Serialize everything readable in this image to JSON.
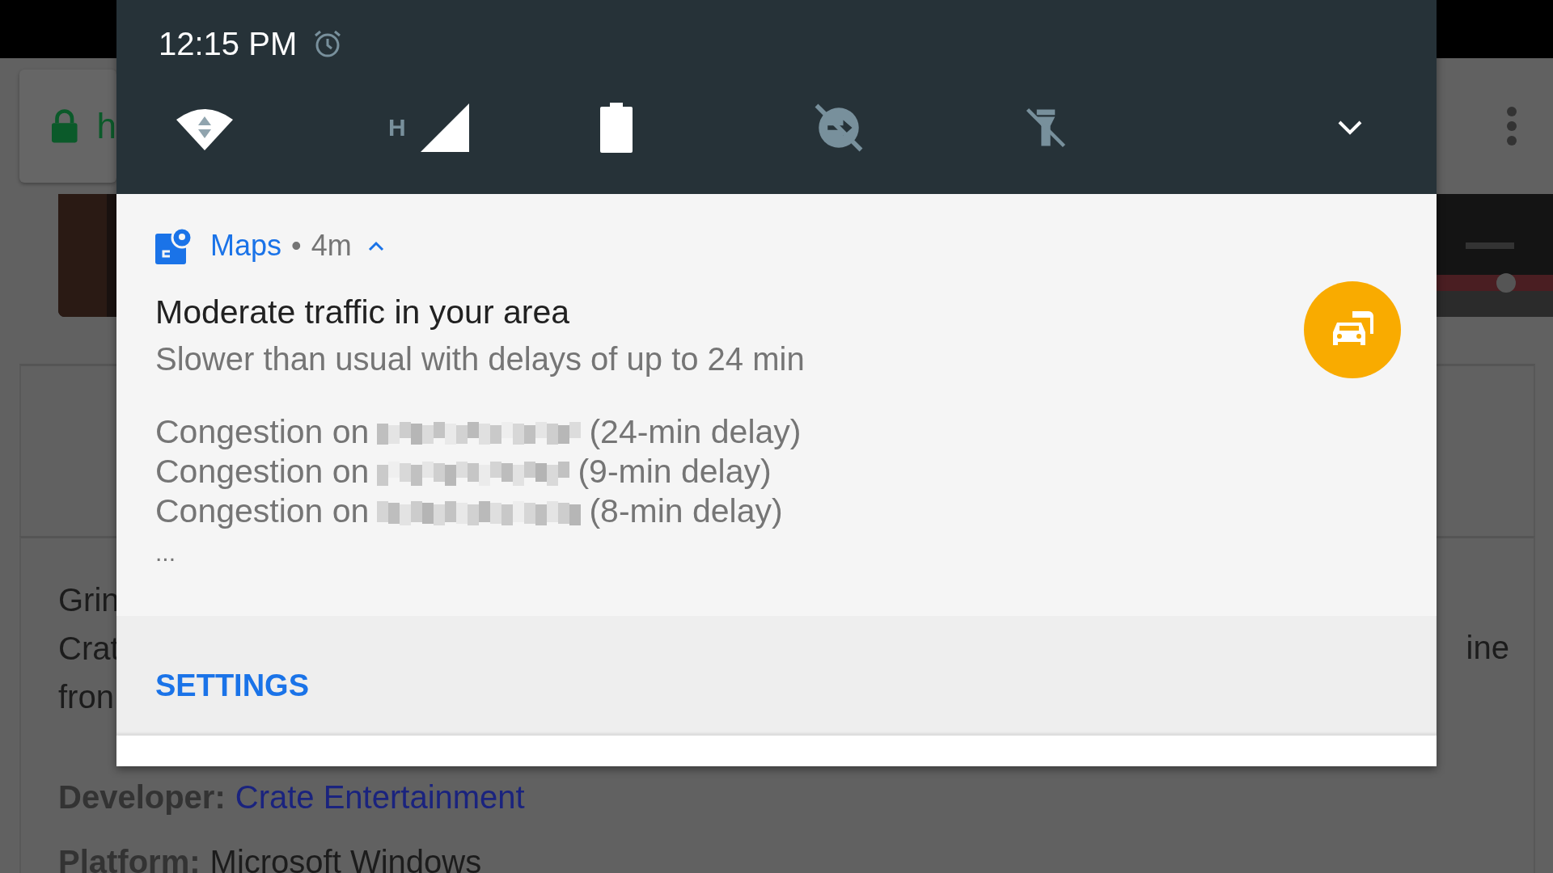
{
  "status_bar": {
    "time": "12:15 PM",
    "alarm": true
  },
  "quick_settings": [
    {
      "kind": "wifi"
    },
    {
      "kind": "mobile",
      "label": "H"
    },
    {
      "kind": "battery"
    },
    {
      "kind": "data_saver",
      "on": false
    },
    {
      "kind": "flashlight",
      "on": false
    }
  ],
  "notification": {
    "app": "Maps",
    "separator": "•",
    "time": "4m",
    "expanded": true,
    "title": "Moderate traffic in your area",
    "text": "Slower than usual with delays of up to 24 min",
    "lines": [
      {
        "prefix": "Congestion on",
        "delay": "(24-min delay)"
      },
      {
        "prefix": "Congestion on",
        "delay": "(9-min delay)"
      },
      {
        "prefix": "Congestion on",
        "delay": "(8-min delay)"
      }
    ],
    "more": "...",
    "action": "SETTINGS"
  },
  "background_page": {
    "url_fragment": "h",
    "paragraph_left": [
      "Grin",
      "Crat",
      "fron"
    ],
    "paragraph_right": [
      "ine"
    ],
    "details": [
      {
        "label": "Developer:",
        "value": "Crate Entertainment",
        "kind": "link"
      },
      {
        "label": "Platform:",
        "value": "Microsoft Windows",
        "kind": "text"
      }
    ]
  }
}
